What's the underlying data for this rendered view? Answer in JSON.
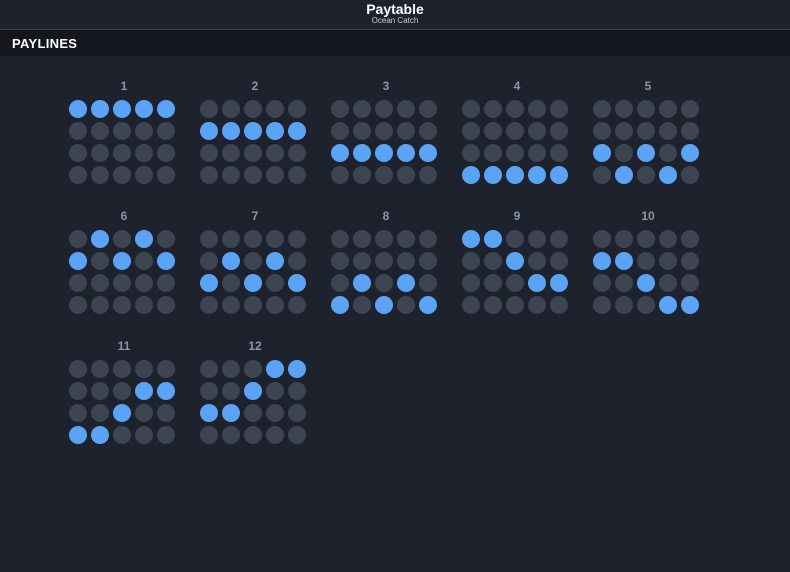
{
  "header": {
    "title": "Paytable",
    "subtitle": "Ocean Catch"
  },
  "section": {
    "title": "PAYLINES"
  },
  "colors": {
    "background": "#1e222d",
    "section_bar": "#13161d",
    "dot_inactive": "#3d4452",
    "dot_active": "#5ba4f5",
    "number_text": "#8a95a8"
  },
  "grid": {
    "rows": 4,
    "cols": 5
  },
  "paylines": [
    {
      "number": "1",
      "rows": [
        0,
        0,
        0,
        0,
        0
      ]
    },
    {
      "number": "2",
      "rows": [
        1,
        1,
        1,
        1,
        1
      ]
    },
    {
      "number": "3",
      "rows": [
        2,
        2,
        2,
        2,
        2
      ]
    },
    {
      "number": "4",
      "rows": [
        3,
        3,
        3,
        3,
        3
      ]
    },
    {
      "number": "5",
      "rows": [
        2,
        3,
        2,
        3,
        2
      ]
    },
    {
      "number": "6",
      "rows": [
        1,
        0,
        1,
        0,
        1
      ]
    },
    {
      "number": "7",
      "rows": [
        2,
        1,
        2,
        1,
        2
      ]
    },
    {
      "number": "8",
      "rows": [
        3,
        2,
        3,
        2,
        3
      ]
    },
    {
      "number": "9",
      "rows": [
        0,
        0,
        1,
        2,
        2
      ]
    },
    {
      "number": "10",
      "rows": [
        1,
        1,
        2,
        3,
        3
      ]
    },
    {
      "number": "11",
      "rows": [
        3,
        3,
        2,
        1,
        1
      ]
    },
    {
      "number": "12",
      "rows": [
        2,
        2,
        1,
        0,
        0
      ]
    }
  ]
}
